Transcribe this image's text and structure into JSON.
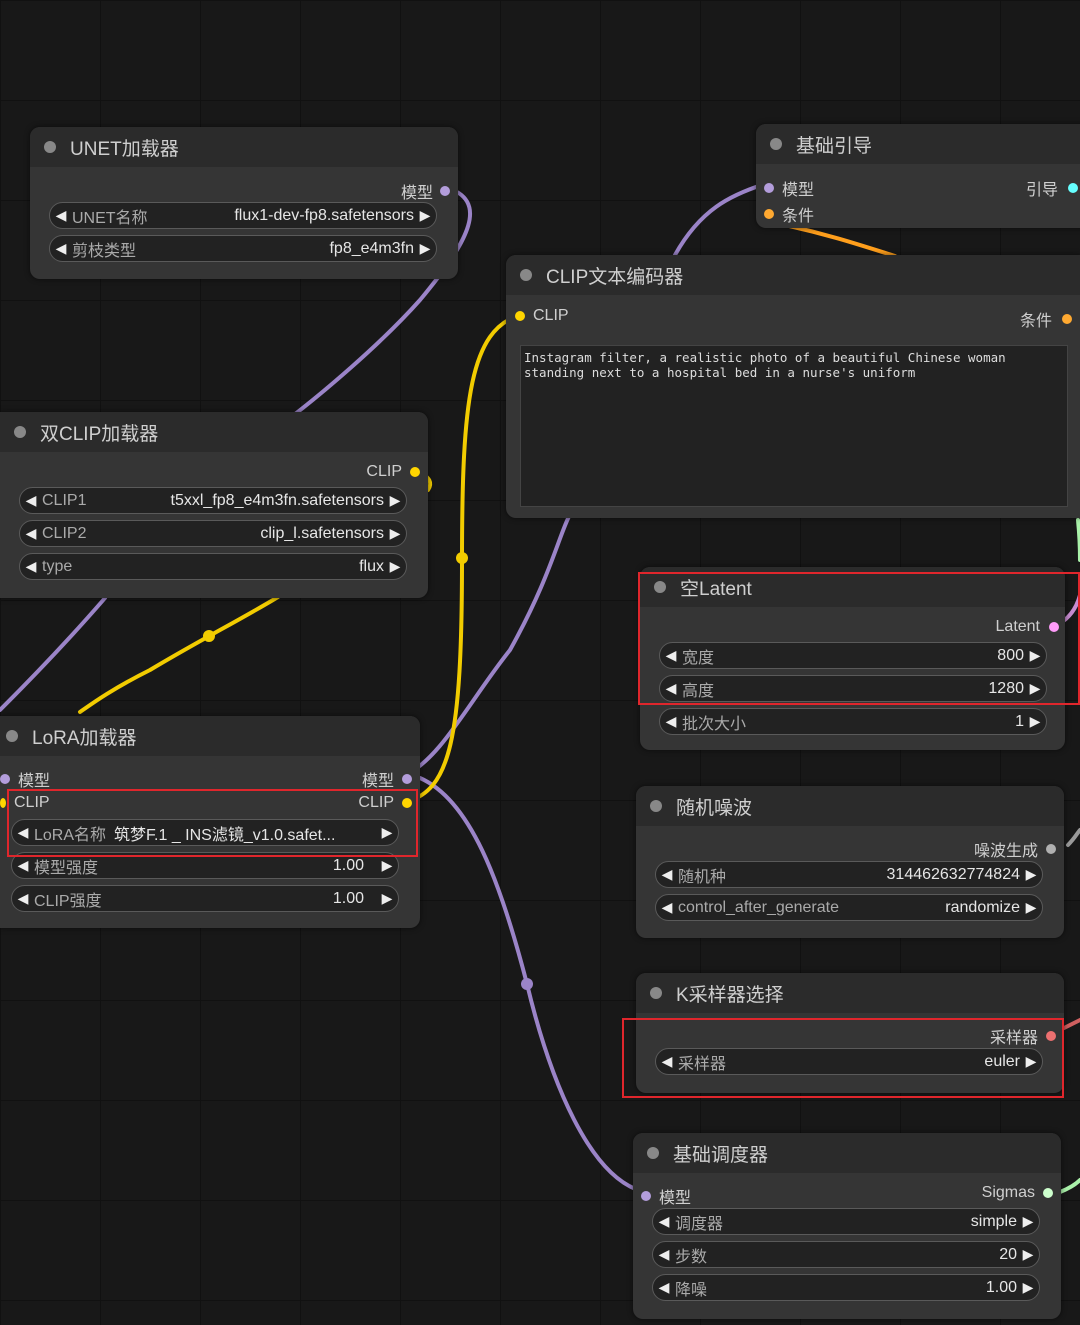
{
  "colors": {
    "model": "#b39ddb",
    "clip": "#ffd500",
    "conditioning": "#ffa931",
    "latent": "#ff9cf9",
    "noise": "#b0b0b0",
    "sampler": "#ec7070",
    "sigmas": "#cdffcd",
    "guide": "#66ffff"
  },
  "unet_loader": {
    "title": "UNET加载器",
    "output": "模型",
    "widgets": [
      {
        "label": "UNET名称",
        "value": "flux1-dev-fp8.safetensors"
      },
      {
        "label": "剪枝类型",
        "value": "fp8_e4m3fn"
      }
    ]
  },
  "basic_guider": {
    "title": "基础引导",
    "inputs": [
      "模型",
      "条件"
    ],
    "output": "引导"
  },
  "clip_text_encoder": {
    "title": "CLIP文本编码器",
    "input": "CLIP",
    "output": "条件",
    "text": "Instagram filter, a realistic photo of a beautiful Chinese woman standing next to a hospital bed in a nurse's uniform"
  },
  "dual_clip_loader": {
    "title": "双CLIP加载器",
    "output": "CLIP",
    "widgets": [
      {
        "label": "CLIP1",
        "value": "t5xxl_fp8_e4m3fn.safetensors"
      },
      {
        "label": "CLIP2",
        "value": "clip_l.safetensors"
      },
      {
        "label": "type",
        "value": "flux"
      }
    ]
  },
  "empty_latent": {
    "title": "空Latent",
    "output": "Latent",
    "widgets": [
      {
        "label": "宽度",
        "value": "800"
      },
      {
        "label": "高度",
        "value": "1280"
      },
      {
        "label": "批次大小",
        "value": "1"
      }
    ]
  },
  "lora_loader": {
    "title": "LoRA加载器",
    "inputs": [
      "模型",
      "CLIP"
    ],
    "outputs": [
      "模型",
      "CLIP"
    ],
    "widgets": [
      {
        "label": "LoRA名称",
        "value": "筑梦F.1 _ INS滤镜_v1.0.safet..."
      },
      {
        "label": "模型强度",
        "value": "1.00"
      },
      {
        "label": "CLIP强度",
        "value": "1.00"
      }
    ]
  },
  "random_noise": {
    "title": "随机噪波",
    "output": "噪波生成",
    "widgets": [
      {
        "label": "随机种",
        "value": "314462632774824"
      },
      {
        "label": "control_after_generate",
        "value": "randomize"
      }
    ]
  },
  "ksampler_select": {
    "title": "K采样器选择",
    "output": "采样器",
    "widgets": [
      {
        "label": "采样器",
        "value": "euler"
      }
    ]
  },
  "basic_scheduler": {
    "title": "基础调度器",
    "input": "模型",
    "output": "Sigmas",
    "widgets": [
      {
        "label": "调度器",
        "value": "simple"
      },
      {
        "label": "步数",
        "value": "20"
      },
      {
        "label": "降噪",
        "value": "1.00"
      }
    ]
  }
}
